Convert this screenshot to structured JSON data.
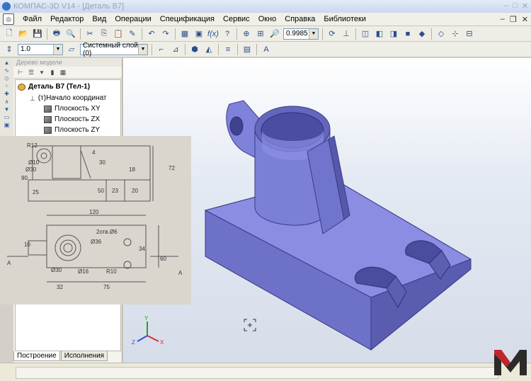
{
  "window": {
    "title": "КОМПАС-3D V14 - [Деталь В7]"
  },
  "menu": {
    "items": [
      "Файл",
      "Редактор",
      "Вид",
      "Операции",
      "Спецификация",
      "Сервис",
      "Окно",
      "Справка",
      "Библиотеки"
    ]
  },
  "toolbar": {
    "zoom_value": "0.9985",
    "line_scale": "1.0",
    "layer": "Системный слой (0)"
  },
  "tree": {
    "panel_title": "Дерево модели",
    "root": "Деталь В7 (Тел-1)",
    "origin": "(т)Начало координат",
    "planes": [
      "Плоскость XY",
      "Плоскость ZX",
      "Плоскость ZY"
    ]
  },
  "tabs": [
    {
      "label": "Построение",
      "active": true
    },
    {
      "label": "Исполнения",
      "active": false
    }
  ],
  "triad": {
    "x": "X",
    "y": "Y",
    "z": "Z"
  },
  "drawing": {
    "dims_top": [
      "R12",
      "72",
      "30",
      "18",
      "25",
      "90",
      "4",
      "50",
      "23",
      "20",
      "Ø30",
      "Ø10"
    ],
    "dims_bottom": [
      "120",
      "2отв.Ø6",
      "Ø36",
      "34",
      "60",
      "10",
      "32",
      "75",
      "Ø30",
      "Ø16",
      "R10",
      "А",
      "А"
    ]
  },
  "colors": {
    "model_face": "#7d80d8",
    "model_dark": "#5a5cb0",
    "viewport_top": "#ffffff",
    "accent": "#3a72c4",
    "logo_red": "#c0262b"
  }
}
